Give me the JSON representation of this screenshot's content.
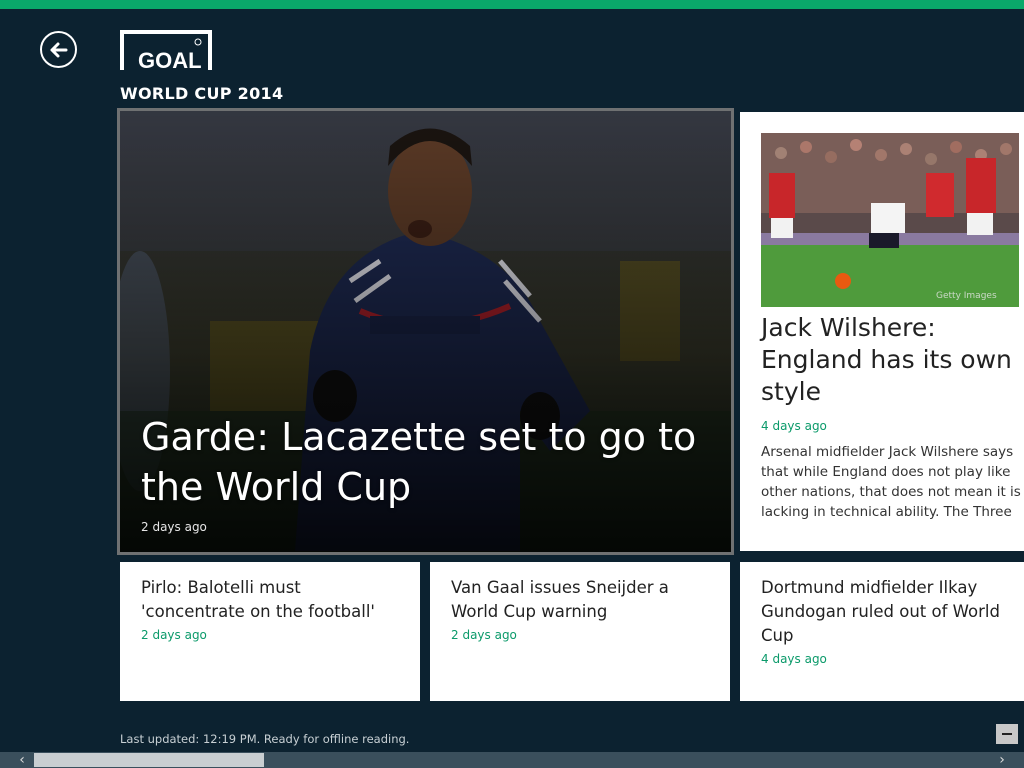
{
  "app": {
    "logo_text": "GOAL",
    "section_title": "WORLD CUP 2014",
    "accent_color": "#0aa86a",
    "background_color": "#0c2230"
  },
  "hero": {
    "title": "Garde: Lacazette set to go to the World Cup",
    "time": "2 days ago"
  },
  "feature": {
    "title": "Jack Wilshere: England has its own style",
    "time": "4 days ago",
    "summary": "Arsenal midfielder Jack Wilshere says that while England does not play like other nations, that does not mean it is lacking in technical ability. The Three",
    "photo_credit": "Getty Images"
  },
  "articles": [
    {
      "title": "Pirlo: Balotelli must 'concentrate on the football'",
      "time": "2 days ago"
    },
    {
      "title": "Van Gaal issues Sneijder a World Cup warning",
      "time": "2 days ago"
    },
    {
      "title": "Dortmund midfielder Ilkay Gundogan ruled out of World Cup",
      "time": "4 days ago"
    }
  ],
  "status": {
    "text": "Last updated: 12:19 PM. Ready for offline reading."
  },
  "icons": {
    "back": "back-arrow-icon",
    "minus": "minus-icon",
    "scroll_left": "chevron-left-icon",
    "scroll_right": "chevron-right-icon"
  },
  "scroll": {
    "position_fraction": 0.0,
    "visible_fraction": 0.23
  }
}
